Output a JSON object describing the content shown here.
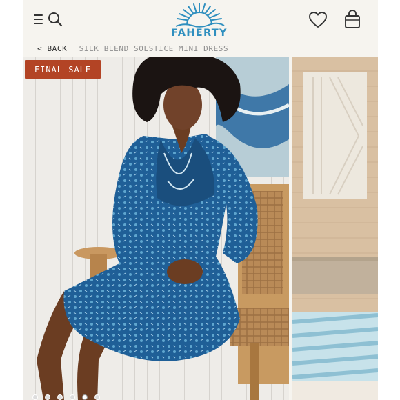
{
  "header": {
    "logo_text": "FAHERTY",
    "icons": {
      "menu": "hamburger-menu-icon",
      "search": "search-icon",
      "wishlist": "heart-icon",
      "cart": "shopping-bag-icon"
    }
  },
  "breadcrumb": {
    "back_label": "< BACK",
    "product_name": "SILK BLEND SOLSTICE MINI DRESS"
  },
  "gallery": {
    "badge": "FINAL SALE",
    "slide_count": 6,
    "active_slide": 5
  },
  "colors": {
    "brand_blue": "#2f8fbf",
    "badge_red": "#b34425",
    "dress_blue": "#1f5f97",
    "background": "#f6f4ef"
  }
}
